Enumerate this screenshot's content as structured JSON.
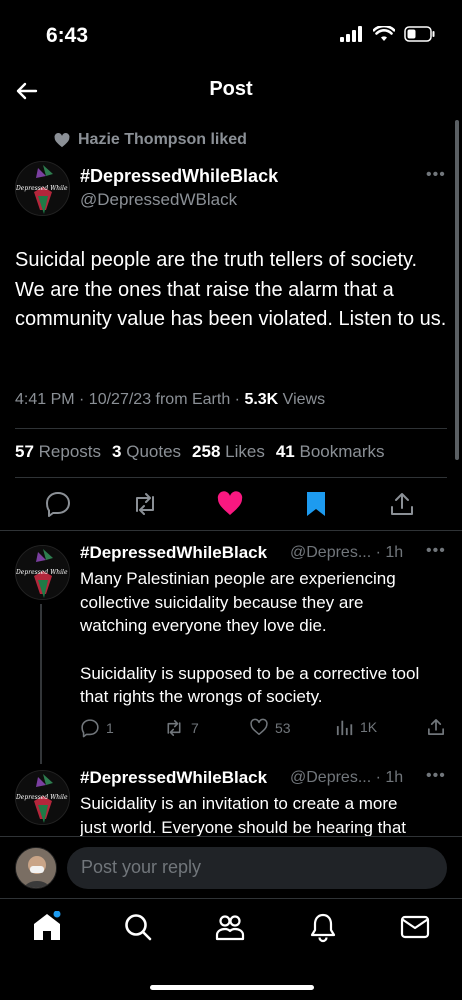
{
  "status": {
    "time": "6:43"
  },
  "nav": {
    "title": "Post"
  },
  "main_post": {
    "liked_by": "Hazie Thompson liked",
    "avatar_text": "Depressed While Black",
    "name": "#DepressedWhileBlack",
    "handle": "@DepressedWBlack",
    "text": "Suicidal people are the truth tellers of society. We are the ones that raise the alarm that a community value has been violated. Listen to us.",
    "meta_time": "4:41 PM · 10/27/23 from Earth · ",
    "views_count": "5.3K",
    "views_label": " Views",
    "stats": {
      "reposts_count": "57",
      "reposts_label": "Reposts",
      "quotes_count": "3",
      "quotes_label": "Quotes",
      "likes_count": "258",
      "likes_label": "Likes",
      "bookmarks_count": "41",
      "bookmarks_label": "Bookmarks"
    }
  },
  "replies": [
    {
      "name": "#DepressedWhileBlack",
      "handle": "@Depres... · 1h",
      "paragraph1": "Many Palestinian people are experiencing collective suicidality because they are watching everyone they love die.",
      "paragraph2": "Suicidality is supposed to be a corrective tool that rights the wrongs of society.",
      "reply_count": "1",
      "repost_count": "7",
      "like_count": "53",
      "view_count": "1K"
    },
    {
      "name": "#DepressedWhileBlack",
      "handle": "@Depres... · 1h",
      "paragraph1": "Suicidality is an invitation to create a more just world. Everyone should be hearing that"
    }
  ],
  "composer": {
    "placeholder": "Post your reply"
  },
  "colors": {
    "background": "#000000",
    "muted_text": "#8b9096",
    "like_pink": "#f91880",
    "bookmark_blue": "#1d9bf0",
    "divider": "#2f3336"
  },
  "icons": [
    "back-arrow-icon",
    "heart-icon",
    "more-icon",
    "reply-icon",
    "repost-icon",
    "bookmark-icon",
    "share-icon",
    "analytics-icon",
    "home-icon",
    "search-icon",
    "communities-icon",
    "notifications-icon",
    "messages-icon"
  ]
}
